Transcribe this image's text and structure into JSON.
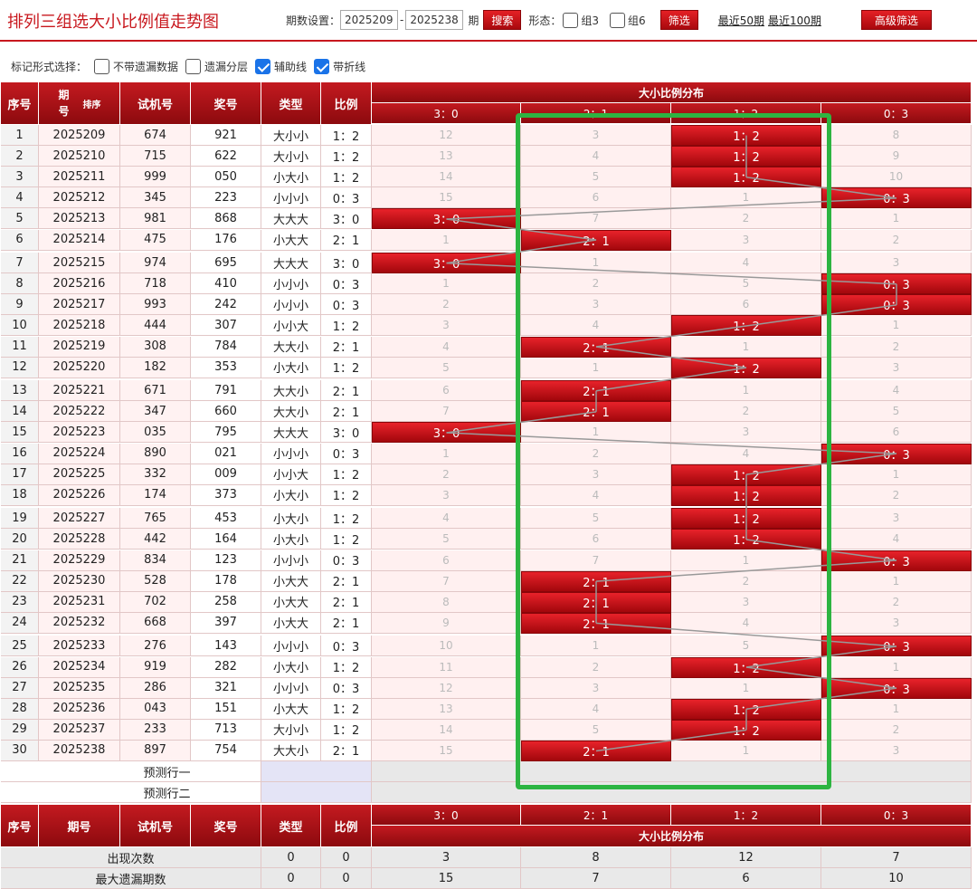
{
  "header": {
    "title": "排列三组选大小比例值走势图",
    "period_label": "期数设置：",
    "start_period": "2025209",
    "dash": "-",
    "end_period": "2025238",
    "period_suffix": "期",
    "search_button": "搜索",
    "form_label": "形态：",
    "group3_label": "组3",
    "group6_label": "组6",
    "filter_button": "筛选",
    "recent50": "最近50期",
    "recent100": "最近100期",
    "advanced_button": "高级筛选"
  },
  "mark": {
    "label": "标记形式选择：",
    "options": [
      {
        "label": "不带遗漏数据",
        "checked": false
      },
      {
        "label": "遗漏分层",
        "checked": false
      },
      {
        "label": "辅助线",
        "checked": true
      },
      {
        "label": "带折线",
        "checked": true
      }
    ]
  },
  "table": {
    "headers": [
      "序号",
      "期号",
      "试机号",
      "奖号",
      "类型",
      "比例"
    ],
    "sort_label": "排序",
    "dist_title": "大小比例分布",
    "dist_cols": [
      "3：0",
      "2：1",
      "1：2",
      "0：3"
    ],
    "rows": [
      {
        "no": "1",
        "period": "2025209",
        "test": "674",
        "prize": "921",
        "type": "大小小",
        "ratio": "1：2",
        "dist": [
          "12",
          "3",
          "1：2",
          "8"
        ],
        "hit": 2
      },
      {
        "no": "2",
        "period": "2025210",
        "test": "715",
        "prize": "622",
        "type": "大小小",
        "ratio": "1：2",
        "dist": [
          "13",
          "4",
          "1：2",
          "9"
        ],
        "hit": 2
      },
      {
        "no": "3",
        "period": "2025211",
        "test": "999",
        "prize": "050",
        "type": "小大小",
        "ratio": "1：2",
        "dist": [
          "14",
          "5",
          "1：2",
          "10"
        ],
        "hit": 2
      },
      {
        "no": "4",
        "period": "2025212",
        "test": "345",
        "prize": "223",
        "type": "小小小",
        "ratio": "0：3",
        "dist": [
          "15",
          "6",
          "1",
          "0：3"
        ],
        "hit": 3
      },
      {
        "no": "5",
        "period": "2025213",
        "test": "981",
        "prize": "868",
        "type": "大大大",
        "ratio": "3：0",
        "dist": [
          "3：0",
          "7",
          "2",
          "1"
        ],
        "hit": 0
      },
      {
        "no": "6",
        "period": "2025214",
        "test": "475",
        "prize": "176",
        "type": "小大大",
        "ratio": "2：1",
        "dist": [
          "1",
          "2：1",
          "3",
          "2"
        ],
        "hit": 1
      },
      {
        "no": "7",
        "period": "2025215",
        "test": "974",
        "prize": "695",
        "type": "大大大",
        "ratio": "3：0",
        "dist": [
          "3：0",
          "1",
          "4",
          "3"
        ],
        "hit": 0
      },
      {
        "no": "8",
        "period": "2025216",
        "test": "718",
        "prize": "410",
        "type": "小小小",
        "ratio": "0：3",
        "dist": [
          "1",
          "2",
          "5",
          "0：3"
        ],
        "hit": 3
      },
      {
        "no": "9",
        "period": "2025217",
        "test": "993",
        "prize": "242",
        "type": "小小小",
        "ratio": "0：3",
        "dist": [
          "2",
          "3",
          "6",
          "0：3"
        ],
        "hit": 3
      },
      {
        "no": "10",
        "period": "2025218",
        "test": "444",
        "prize": "307",
        "type": "小小大",
        "ratio": "1：2",
        "dist": [
          "3",
          "4",
          "1：2",
          "1"
        ],
        "hit": 2
      },
      {
        "no": "11",
        "period": "2025219",
        "test": "308",
        "prize": "784",
        "type": "大大小",
        "ratio": "2：1",
        "dist": [
          "4",
          "2：1",
          "1",
          "2"
        ],
        "hit": 1
      },
      {
        "no": "12",
        "period": "2025220",
        "test": "182",
        "prize": "353",
        "type": "小大小",
        "ratio": "1：2",
        "dist": [
          "5",
          "1",
          "1：2",
          "3"
        ],
        "hit": 2
      },
      {
        "no": "13",
        "period": "2025221",
        "test": "671",
        "prize": "791",
        "type": "大大小",
        "ratio": "2：1",
        "dist": [
          "6",
          "2：1",
          "1",
          "4"
        ],
        "hit": 1
      },
      {
        "no": "14",
        "period": "2025222",
        "test": "347",
        "prize": "660",
        "type": "大大小",
        "ratio": "2：1",
        "dist": [
          "7",
          "2：1",
          "2",
          "5"
        ],
        "hit": 1
      },
      {
        "no": "15",
        "period": "2025223",
        "test": "035",
        "prize": "795",
        "type": "大大大",
        "ratio": "3：0",
        "dist": [
          "3：0",
          "1",
          "3",
          "6"
        ],
        "hit": 0
      },
      {
        "no": "16",
        "period": "2025224",
        "test": "890",
        "prize": "021",
        "type": "小小小",
        "ratio": "0：3",
        "dist": [
          "1",
          "2",
          "4",
          "0：3"
        ],
        "hit": 3
      },
      {
        "no": "17",
        "period": "2025225",
        "test": "332",
        "prize": "009",
        "type": "小小大",
        "ratio": "1：2",
        "dist": [
          "2",
          "3",
          "1：2",
          "1"
        ],
        "hit": 2
      },
      {
        "no": "18",
        "period": "2025226",
        "test": "174",
        "prize": "373",
        "type": "小大小",
        "ratio": "1：2",
        "dist": [
          "3",
          "4",
          "1：2",
          "2"
        ],
        "hit": 2
      },
      {
        "no": "19",
        "period": "2025227",
        "test": "765",
        "prize": "453",
        "type": "小大小",
        "ratio": "1：2",
        "dist": [
          "4",
          "5",
          "1：2",
          "3"
        ],
        "hit": 2
      },
      {
        "no": "20",
        "period": "2025228",
        "test": "442",
        "prize": "164",
        "type": "小大小",
        "ratio": "1：2",
        "dist": [
          "5",
          "6",
          "1：2",
          "4"
        ],
        "hit": 2
      },
      {
        "no": "21",
        "period": "2025229",
        "test": "834",
        "prize": "123",
        "type": "小小小",
        "ratio": "0：3",
        "dist": [
          "6",
          "7",
          "1",
          "0：3"
        ],
        "hit": 3
      },
      {
        "no": "22",
        "period": "2025230",
        "test": "528",
        "prize": "178",
        "type": "小大大",
        "ratio": "2：1",
        "dist": [
          "7",
          "2：1",
          "2",
          "1"
        ],
        "hit": 1
      },
      {
        "no": "23",
        "period": "2025231",
        "test": "702",
        "prize": "258",
        "type": "小大大",
        "ratio": "2：1",
        "dist": [
          "8",
          "2：1",
          "3",
          "2"
        ],
        "hit": 1
      },
      {
        "no": "24",
        "period": "2025232",
        "test": "668",
        "prize": "397",
        "type": "小大大",
        "ratio": "2：1",
        "dist": [
          "9",
          "2：1",
          "4",
          "3"
        ],
        "hit": 1
      },
      {
        "no": "25",
        "period": "2025233",
        "test": "276",
        "prize": "143",
        "type": "小小小",
        "ratio": "0：3",
        "dist": [
          "10",
          "1",
          "5",
          "0：3"
        ],
        "hit": 3
      },
      {
        "no": "26",
        "period": "2025234",
        "test": "919",
        "prize": "282",
        "type": "小大小",
        "ratio": "1：2",
        "dist": [
          "11",
          "2",
          "1：2",
          "1"
        ],
        "hit": 2
      },
      {
        "no": "27",
        "period": "2025235",
        "test": "286",
        "prize": "321",
        "type": "小小小",
        "ratio": "0：3",
        "dist": [
          "12",
          "3",
          "1",
          "0：3"
        ],
        "hit": 3
      },
      {
        "no": "28",
        "period": "2025236",
        "test": "043",
        "prize": "151",
        "type": "小大大",
        "ratio": "1：2",
        "dist": [
          "13",
          "4",
          "1：2",
          "1"
        ],
        "hit": 2
      },
      {
        "no": "29",
        "period": "2025237",
        "test": "233",
        "prize": "713",
        "type": "大小小",
        "ratio": "1：2",
        "dist": [
          "14",
          "5",
          "1：2",
          "2"
        ],
        "hit": 2
      },
      {
        "no": "30",
        "period": "2025238",
        "test": "897",
        "prize": "754",
        "type": "大大小",
        "ratio": "2：1",
        "dist": [
          "15",
          "2：1",
          "1",
          "3"
        ],
        "hit": 1
      }
    ],
    "predict1": "预测行一",
    "predict2": "预测行二",
    "stats": [
      {
        "label": "出现次数",
        "a": "0",
        "b": "0",
        "dist": [
          "3",
          "8",
          "12",
          "7"
        ]
      },
      {
        "label": "最大遗漏期数",
        "a": "0",
        "b": "0",
        "dist": [
          "15",
          "7",
          "6",
          "10"
        ]
      }
    ]
  },
  "colors": {
    "accent": "#c8181e",
    "highlight": "#2db441"
  }
}
